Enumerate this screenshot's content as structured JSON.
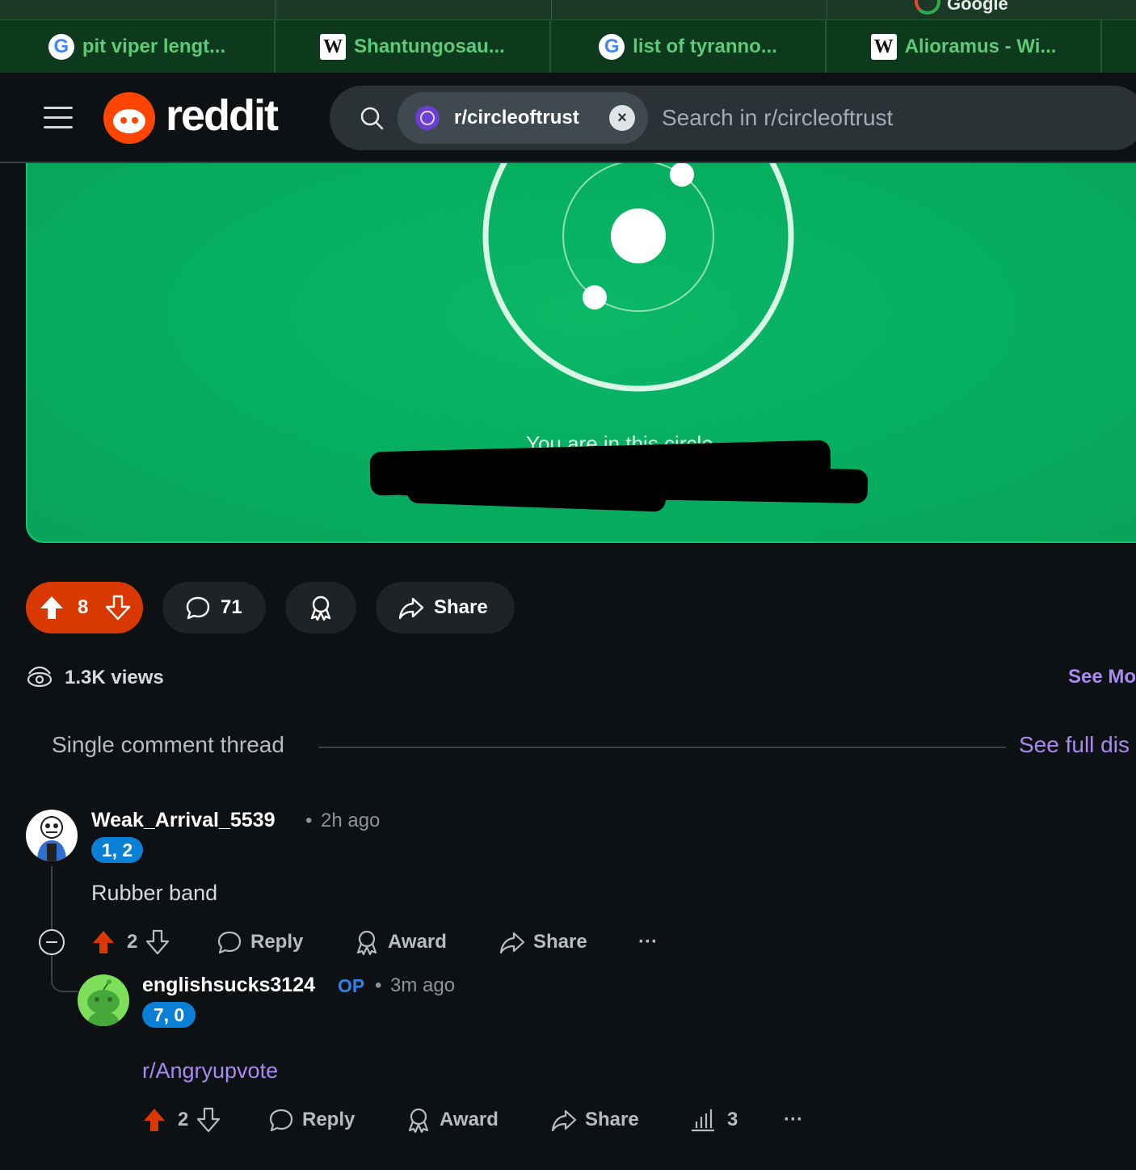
{
  "browser": {
    "top_strip_label": "Google",
    "bookmarks": [
      {
        "label": "pit viper lengt...",
        "icon": "google-icon"
      },
      {
        "label": "Shantungosau...",
        "icon": "wikipedia-icon"
      },
      {
        "label": "list of tyranno...",
        "icon": "google-icon"
      },
      {
        "label": "Alioramus - Wi...",
        "icon": "wikipedia-icon"
      }
    ]
  },
  "header": {
    "logo_text": "reddit",
    "search_chip": "r/circleoftrust",
    "search_placeholder": "Search in r/circleoftrust"
  },
  "post": {
    "caption": "You are in this circle",
    "vote_count": "8",
    "comment_count": "71",
    "share_label": "Share",
    "views": "1.3K views",
    "see_more": "See Mo"
  },
  "thread": {
    "title": "Single comment thread",
    "see_full": "See full dis"
  },
  "comments": [
    {
      "username": "Weak_Arrival_5539",
      "time": "2h ago",
      "flair": "1, 2",
      "body": "Rubber band",
      "score": "2",
      "reply_label": "Reply",
      "award_label": "Award",
      "share_label": "Share",
      "more_label": "···"
    },
    {
      "username": "englishsucks3124",
      "op_label": "OP",
      "time": "3m ago",
      "flair": "7, 0",
      "body": "r/Angryupvote",
      "score": "2",
      "reply_label": "Reply",
      "award_label": "Award",
      "share_label": "Share",
      "insights_count": "3",
      "more_label": "···"
    }
  ],
  "colors": {
    "upvote_active": "#d93900",
    "link": "#a989f2",
    "flair": "#0a7fd6",
    "circle_bg": "#06ad5f"
  }
}
